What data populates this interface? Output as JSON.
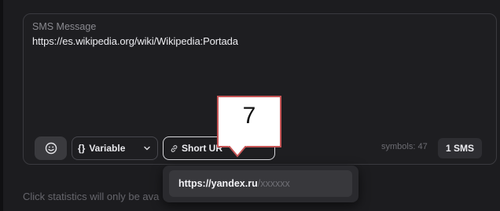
{
  "sms": {
    "label": "SMS Message",
    "value": "https://es.wikipedia.org/wiki/Wikipedia:Portada"
  },
  "toolbar": {
    "emoji_icon": "smiley-icon",
    "variable_braces": "{}",
    "variable_label": "Variable",
    "short_url_label": "Short UR",
    "symbols_label": "symbols: 47",
    "sms_count": "1 SMS"
  },
  "popup": {
    "items": [
      {
        "domain": "https://yandex.ru",
        "suffix": "/xxxxxx"
      }
    ]
  },
  "footer": {
    "note": "Click statistics will only be ava"
  },
  "callout": {
    "number": "7"
  },
  "colors": {
    "background": "#1c1c1f",
    "callout_border": "#c65556"
  }
}
